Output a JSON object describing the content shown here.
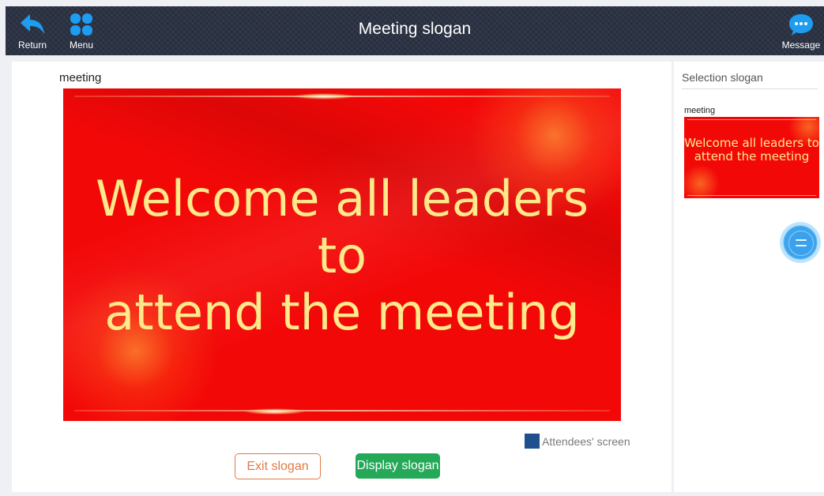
{
  "header": {
    "title": "Meeting slogan",
    "return_label": "Return",
    "menu_label": "Menu",
    "message_label": "Message"
  },
  "main": {
    "slogan_name": "meeting",
    "banner_text_line1": "Welcome all leaders to",
    "banner_text_line2": "attend the meeting",
    "attendees_label": "Attendees' screen",
    "exit_label": "Exit slogan",
    "display_label": "Display slogan"
  },
  "sidebar": {
    "title": "Selection slogan",
    "items": [
      {
        "label": "meeting",
        "text_line1": "Welcome all leaders to",
        "text_line2": "attend the meeting"
      }
    ]
  },
  "colors": {
    "header_bg": "#2c3344",
    "accent_blue": "#1e9cf0",
    "banner_red": "#f30808",
    "banner_text": "#ffe98a",
    "exit_orange": "#e07a44",
    "display_green": "#25a858",
    "attendees_swatch": "#1f4f8c"
  },
  "icons": {
    "return": "return-arrow-icon",
    "menu": "four-petal-menu-icon",
    "message": "chat-bubble-icon",
    "floating": "floating-menu-icon"
  }
}
